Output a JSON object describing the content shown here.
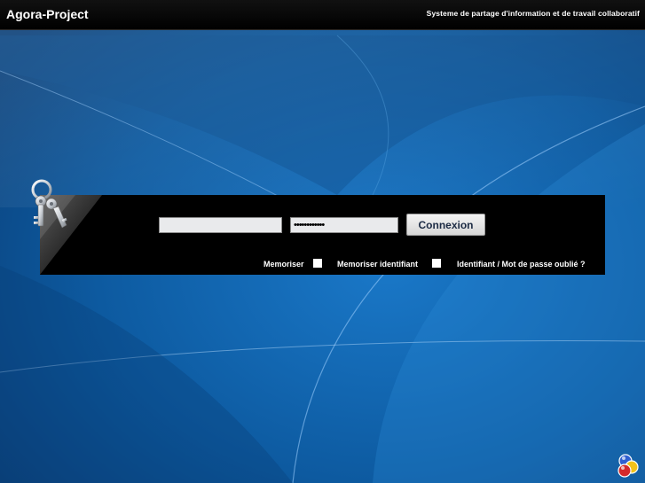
{
  "app": {
    "title": "Agora-Project",
    "tagline": "Systeme de partage d'information et de travail collaboratif"
  },
  "login": {
    "username_value": "",
    "password_value": "••••••••••••",
    "connect_label": "Connexion",
    "remember_label": "Memoriser",
    "remember_checked": false,
    "remember_id_label": "Memoriser identifiant",
    "remember_id_checked": false,
    "forgot_label": "Identifiant / Mot de passe oublié ?"
  },
  "icons": {
    "keys": "keys-icon",
    "logo": "agora-logo-icon"
  },
  "colors": {
    "background": "#0d5aa0",
    "topbar": "#000000",
    "panel": "#000000",
    "button_text": "#1c2b44"
  }
}
